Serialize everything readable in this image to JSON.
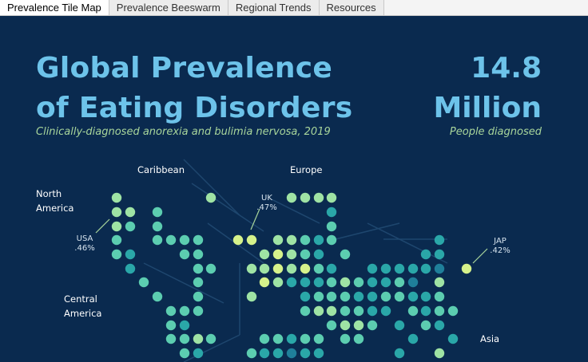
{
  "tabs": [
    {
      "label": "Prevalence Tile Map",
      "active": true
    },
    {
      "label": "Prevalence Beeswarm",
      "active": false
    },
    {
      "label": "Regional Trends",
      "active": false
    },
    {
      "label": "Resources",
      "active": false
    }
  ],
  "header": {
    "title_line1": "Global Prevalence",
    "title_line2": "of Eating Disorders",
    "subtitle": "Clinically-diagnosed anorexia and bulimia nervosa, 2019",
    "stat_line1": "14.8",
    "stat_line2": "Million",
    "stat_label": "People diagnosed"
  },
  "regions": {
    "north_america_1": "North",
    "north_america_2": "America",
    "caribbean": "Caribbean",
    "europe": "Europe",
    "central_america_1": "Central",
    "central_america_2": "America",
    "asia": "Asia"
  },
  "callouts": {
    "usa_code": "USA",
    "usa_value": ".46%",
    "uk_code": "UK",
    "uk_value": ".47%",
    "jap_code": "JAP",
    "jap_value": ".42%"
  },
  "colors": {
    "background": "#0a2a4f",
    "title": "#6dc3ea",
    "subtitle": "#a8d59b",
    "scale": [
      "#1a4f7a",
      "#1f7f9a",
      "#2aa7a8",
      "#5ccdb0",
      "#9fe3a4",
      "#d6f28b"
    ]
  }
}
